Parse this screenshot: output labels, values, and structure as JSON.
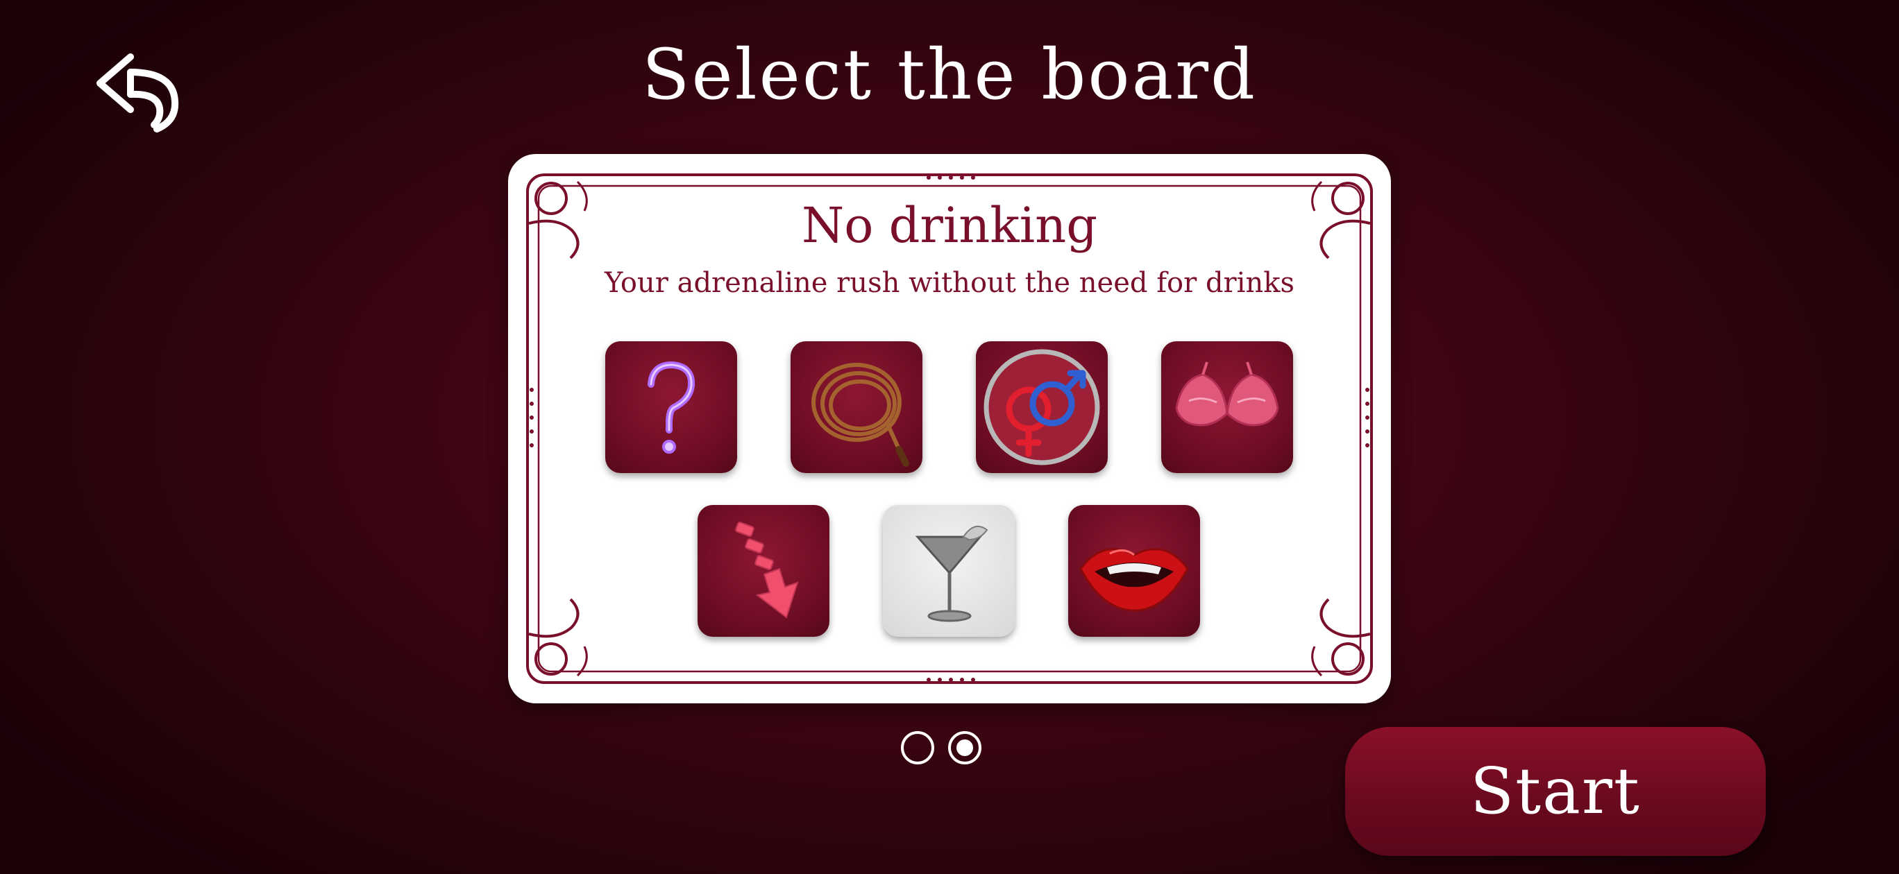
{
  "header": {
    "title": "Select the board",
    "back_icon": "back-arrow-icon"
  },
  "board": {
    "name": "No drinking",
    "description": "Your adrenaline rush without the need for drinks",
    "tiles": [
      {
        "icon": "question-mark-icon"
      },
      {
        "icon": "whip-icon"
      },
      {
        "icon": "gender-symbols-icon"
      },
      {
        "icon": "bra-icon"
      },
      {
        "icon": "down-arrow-icon"
      },
      {
        "icon": "cocktail-glass-icon"
      },
      {
        "icon": "lips-icon"
      }
    ]
  },
  "pager": {
    "pages": 2,
    "current_page": 2
  },
  "actions": {
    "start_label": "Start"
  },
  "colors": {
    "accent": "#7a0f2b",
    "background": "#3d0512",
    "card": "#ffffff"
  }
}
